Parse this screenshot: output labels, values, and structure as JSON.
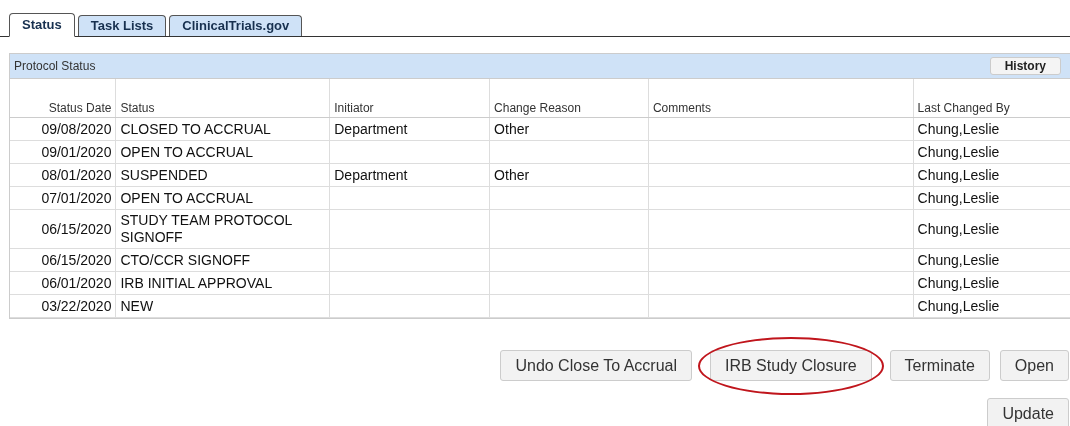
{
  "tabs": [
    {
      "label": "Status",
      "selected": true
    },
    {
      "label": "Task Lists",
      "selected": false
    },
    {
      "label": "ClinicalTrials.gov",
      "selected": false
    }
  ],
  "panel": {
    "title": "Protocol Status",
    "history_button": "History"
  },
  "table": {
    "columns": [
      "Status Date",
      "Status",
      "Initiator",
      "Change Reason",
      "Comments",
      "Last Changed By"
    ],
    "rows": [
      [
        "09/08/2020",
        "CLOSED TO ACCRUAL",
        "Department",
        "Other",
        "",
        "Chung,Leslie"
      ],
      [
        "09/01/2020",
        "OPEN TO ACCRUAL",
        "",
        "",
        "",
        "Chung,Leslie"
      ],
      [
        "08/01/2020",
        "SUSPENDED",
        "Department",
        "Other",
        "",
        "Chung,Leslie"
      ],
      [
        "07/01/2020",
        "OPEN TO ACCRUAL",
        "",
        "",
        "",
        "Chung,Leslie"
      ],
      [
        "06/15/2020",
        "STUDY TEAM PROTOCOL SIGNOFF",
        "",
        "",
        "",
        "Chung,Leslie"
      ],
      [
        "06/15/2020",
        "CTO/CCR SIGNOFF",
        "",
        "",
        "",
        "Chung,Leslie"
      ],
      [
        "06/01/2020",
        "IRB INITIAL APPROVAL",
        "",
        "",
        "",
        "Chung,Leslie"
      ],
      [
        "03/22/2020",
        "NEW",
        "",
        "",
        "",
        "Chung,Leslie"
      ]
    ]
  },
  "actions": [
    {
      "label": "Undo Close To Accrual",
      "circled": false
    },
    {
      "label": "IRB Study Closure",
      "circled": true
    },
    {
      "label": "Terminate",
      "circled": false
    },
    {
      "label": "Open",
      "circled": false
    }
  ],
  "update_button": "Update"
}
